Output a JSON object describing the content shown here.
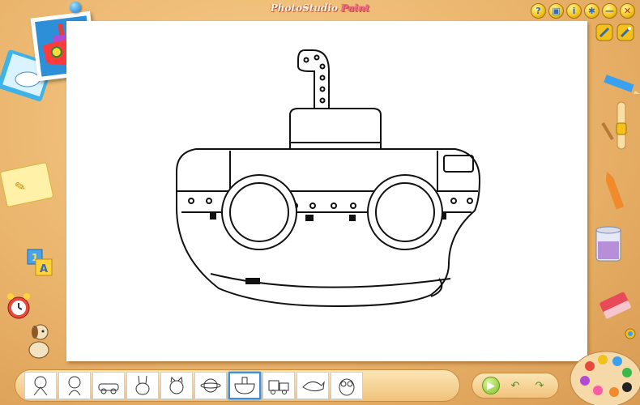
{
  "app": {
    "title_part1": "PhotoStudio",
    "title_part2": "Paint"
  },
  "window_buttons": [
    {
      "name": "help-button",
      "glyph": "?"
    },
    {
      "name": "gallery-button",
      "glyph": "▣"
    },
    {
      "name": "info-button",
      "glyph": "i"
    },
    {
      "name": "settings-button",
      "glyph": "✱"
    },
    {
      "name": "minimize-button",
      "glyph": "—"
    },
    {
      "name": "close-button",
      "glyph": "✕"
    }
  ],
  "colors": {
    "accent_blue": "#2c8fd8",
    "button_yellow": "#f3c11c",
    "paint_pink": "#ff5aa8"
  },
  "thumbnails": [
    {
      "name": "thumb-clown",
      "selected": false
    },
    {
      "name": "thumb-girl",
      "selected": false
    },
    {
      "name": "thumb-car",
      "selected": false
    },
    {
      "name": "thumb-rabbit",
      "selected": false
    },
    {
      "name": "thumb-cat",
      "selected": false
    },
    {
      "name": "thumb-planet",
      "selected": false
    },
    {
      "name": "thumb-submarine",
      "selected": true
    },
    {
      "name": "thumb-train",
      "selected": false
    },
    {
      "name": "thumb-whale",
      "selected": false
    },
    {
      "name": "thumb-owl",
      "selected": false
    }
  ],
  "nav": {
    "play_glyph": "▶",
    "undo_glyph": "↶",
    "redo_glyph": "↷"
  }
}
